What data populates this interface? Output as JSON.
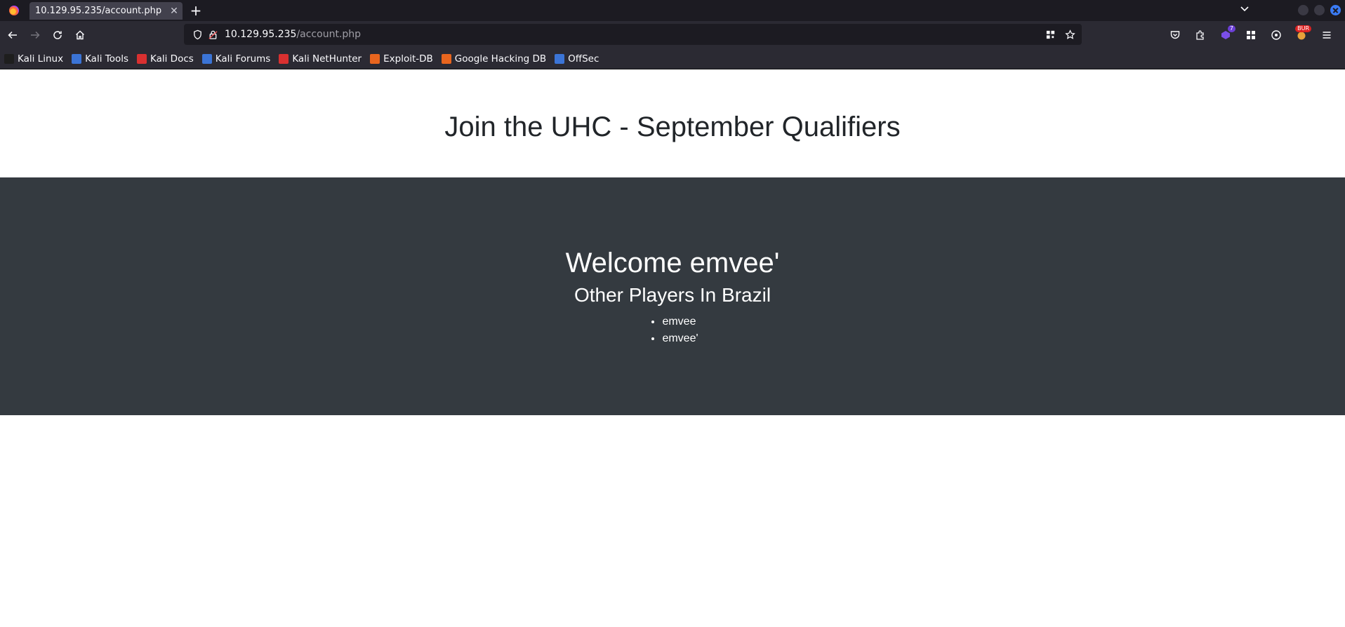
{
  "browser": {
    "tab": {
      "title": "10.129.95.235/account.php",
      "close": "✕"
    },
    "new_tab": "+",
    "url": {
      "host": "10.129.95.235",
      "path": "/account.php"
    }
  },
  "bookmarks": [
    {
      "label": "Kali Linux",
      "color": "#1e1e1e"
    },
    {
      "label": "Kali Tools",
      "color": "#3b74d6"
    },
    {
      "label": "Kali Docs",
      "color": "#d93030"
    },
    {
      "label": "Kali Forums",
      "color": "#3b74d6"
    },
    {
      "label": "Kali NetHunter",
      "color": "#d93030"
    },
    {
      "label": "Exploit-DB",
      "color": "#e8651e"
    },
    {
      "label": "Google Hacking DB",
      "color": "#e8651e"
    },
    {
      "label": "OffSec",
      "color": "#3b74d6"
    }
  ],
  "extensions": {
    "badge_count": "7",
    "burp_badge": "BUR"
  },
  "page": {
    "heading": "Join the UHC - September Qualifiers",
    "welcome": "Welcome emvee'",
    "subheading": "Other Players In Brazil",
    "players": [
      "emvee",
      "emvee'"
    ]
  },
  "colors": {
    "dark_section": "#343a40",
    "heading_text": "#212529"
  }
}
